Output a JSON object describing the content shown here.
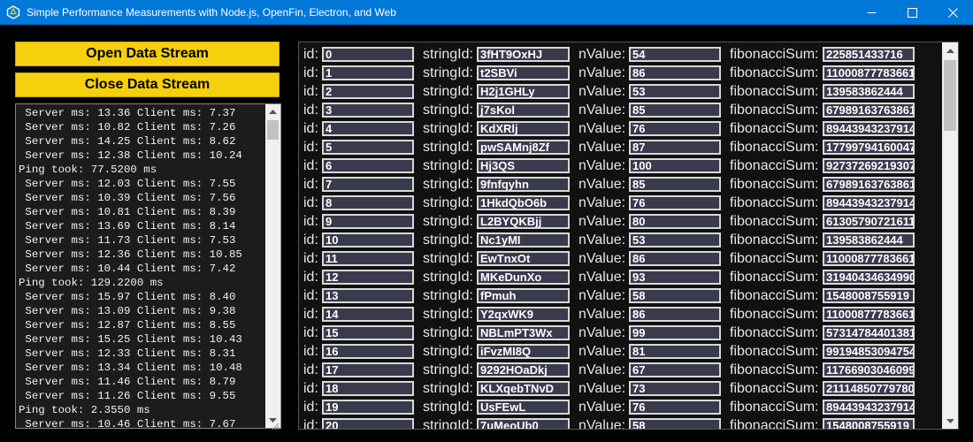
{
  "window": {
    "title": "Simple Performance Measurements with Node.js, OpenFin, Electron, and Web",
    "accent": "#0078d7"
  },
  "controls": {
    "open_label": "Open Data Stream",
    "close_label": "Close Data Stream",
    "button_color": "#f5d00c"
  },
  "log": {
    "lines": [
      " Server ms: 13.36 Client ms: 7.37",
      " Server ms: 10.82 Client ms: 7.26",
      " Server ms: 14.25 Client ms: 8.62",
      " Server ms: 12.38 Client ms: 10.24",
      "Ping took: 77.5200 ms",
      " Server ms: 12.03 Client ms: 7.55",
      " Server ms: 10.39 Client ms: 7.56",
      " Server ms: 10.81 Client ms: 8.39",
      " Server ms: 13.69 Client ms: 8.14",
      " Server ms: 11.73 Client ms: 7.53",
      " Server ms: 12.36 Client ms: 10.85",
      " Server ms: 10.44 Client ms: 7.42",
      "Ping took: 129.2200 ms",
      " Server ms: 15.97 Client ms: 8.40",
      " Server ms: 13.09 Client ms: 9.38",
      " Server ms: 12.87 Client ms: 8.55",
      " Server ms: 15.25 Client ms: 10.43",
      " Server ms: 12.33 Client ms: 8.31",
      " Server ms: 13.34 Client ms: 10.48",
      " Server ms: 11.46 Client ms: 8.79",
      " Server ms: 11.26 Client ms: 9.55",
      "Ping took: 2.3550 ms",
      " Server ms: 10.46 Client ms: 7.67"
    ]
  },
  "labels": {
    "id": "id:",
    "stringId": "stringId:",
    "nValue": "nValue:",
    "fibonacciSum": "fibonacciSum:"
  },
  "rows": [
    {
      "id": "0",
      "stringId": "3fHT9OxHJ",
      "nValue": "54",
      "fibonacciSum": "225851433716"
    },
    {
      "id": "1",
      "stringId": "t2SBVi",
      "nValue": "86",
      "fibonacciSum": "110008777836610"
    },
    {
      "id": "2",
      "stringId": "H2j1GHLy",
      "nValue": "53",
      "fibonacciSum": "139583862444"
    },
    {
      "id": "3",
      "stringId": "j7sKol",
      "nValue": "85",
      "fibonacciSum": "67989163763861"
    },
    {
      "id": "4",
      "stringId": "KdXRlj",
      "nValue": "76",
      "fibonacciSum": "89443943237914"
    },
    {
      "id": "5",
      "stringId": "pwSAMnj8Zf",
      "nValue": "87",
      "fibonacciSum": "17799794160047"
    },
    {
      "id": "6",
      "stringId": "Hj3QS",
      "nValue": "100",
      "fibonacciSum": "92737269219307"
    },
    {
      "id": "7",
      "stringId": "9fnfqyhn",
      "nValue": "85",
      "fibonacciSum": "67989163763861"
    },
    {
      "id": "8",
      "stringId": "1HkdQbO6b",
      "nValue": "76",
      "fibonacciSum": "89443943237914"
    },
    {
      "id": "9",
      "stringId": "L2BYQKBjj",
      "nValue": "80",
      "fibonacciSum": "61305790721611"
    },
    {
      "id": "10",
      "stringId": "Nc1yMI",
      "nValue": "53",
      "fibonacciSum": "139583862444"
    },
    {
      "id": "11",
      "stringId": "EwTnxOt",
      "nValue": "86",
      "fibonacciSum": "110008777836610"
    },
    {
      "id": "12",
      "stringId": "MKeDunXo",
      "nValue": "93",
      "fibonacciSum": "31940434634990"
    },
    {
      "id": "13",
      "stringId": "fPmuh",
      "nValue": "58",
      "fibonacciSum": "1548008755919"
    },
    {
      "id": "14",
      "stringId": "Y2qxWK9",
      "nValue": "86",
      "fibonacciSum": "110008777836610"
    },
    {
      "id": "15",
      "stringId": "NBLmPT3Wx",
      "nValue": "99",
      "fibonacciSum": "57314784401381"
    },
    {
      "id": "16",
      "stringId": "iFvzMI8Q",
      "nValue": "81",
      "fibonacciSum": "99194853094754"
    },
    {
      "id": "17",
      "stringId": "9292HOaDkj",
      "nValue": "67",
      "fibonacciSum": "11766903046099"
    },
    {
      "id": "18",
      "stringId": "KLXqebTNvD",
      "nValue": "73",
      "fibonacciSum": "21114850779780"
    },
    {
      "id": "19",
      "stringId": "UsFEwL",
      "nValue": "76",
      "fibonacciSum": "89443943237914"
    },
    {
      "id": "20",
      "stringId": "7uMeoUb0",
      "nValue": "58",
      "fibonacciSum": "1548008755919"
    }
  ]
}
